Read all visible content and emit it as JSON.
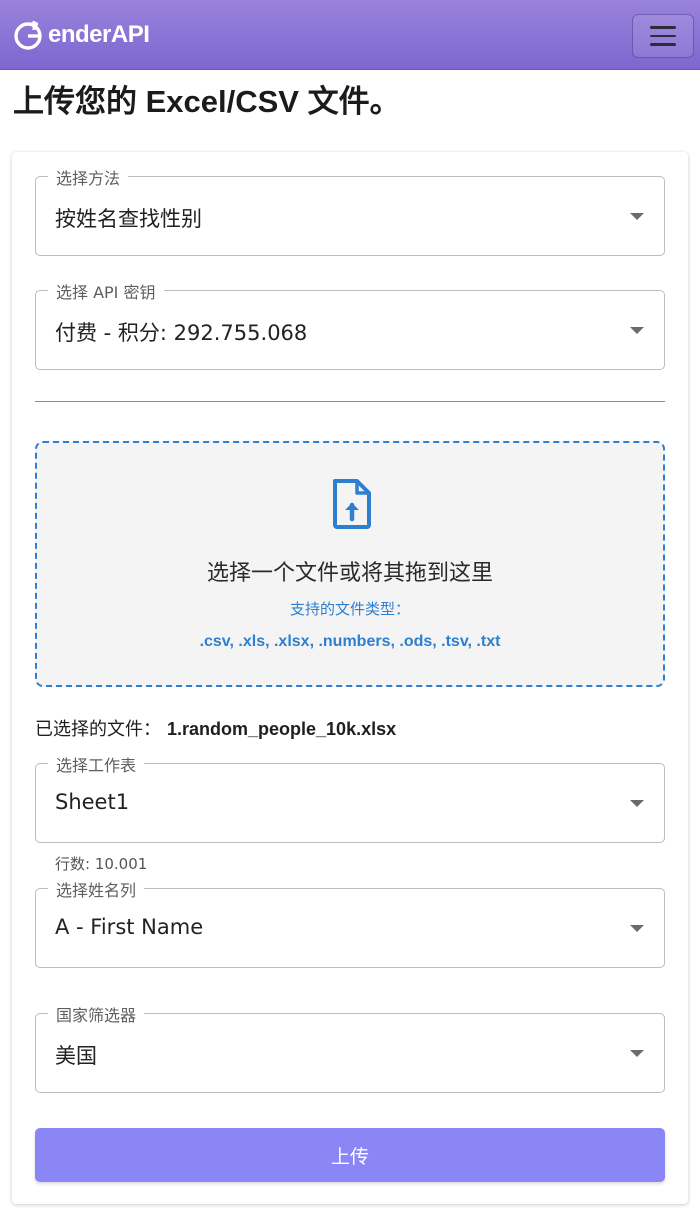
{
  "header": {
    "brand": "GenderAPI",
    "brand_icon": "genderapi-logo-icon",
    "menu_icon": "hamburger-menu-icon",
    "brand_color": "#8b74d6"
  },
  "page": {
    "title": "上传您的 Excel/CSV 文件。"
  },
  "form": {
    "method": {
      "label": "选择方法",
      "value": "按姓名查找性别"
    },
    "api_key": {
      "label": "选择 API 密钥",
      "value": "付费 - 积分: 292.755.068"
    },
    "dropzone": {
      "title": "选择一个文件或将其拖到这里",
      "types_label": "支持的文件类型：",
      "types": ".csv, .xls, .xlsx, .numbers, .ods, .tsv, .txt",
      "icon": "file-upload-icon",
      "accent_color": "#2e7fd0"
    },
    "selected_file": {
      "label": "已选择的文件：",
      "name": "1.random_people_10k.xlsx"
    },
    "sheet": {
      "label": "选择工作表",
      "value": "Sheet1",
      "rows_text": "行数: 10.001"
    },
    "name_column": {
      "label": "选择姓名列",
      "value": "A - First Name"
    },
    "country": {
      "label": "国家筛选器",
      "value": "美国"
    },
    "upload_button": {
      "label": "上传",
      "color": "#8a86f6"
    }
  }
}
